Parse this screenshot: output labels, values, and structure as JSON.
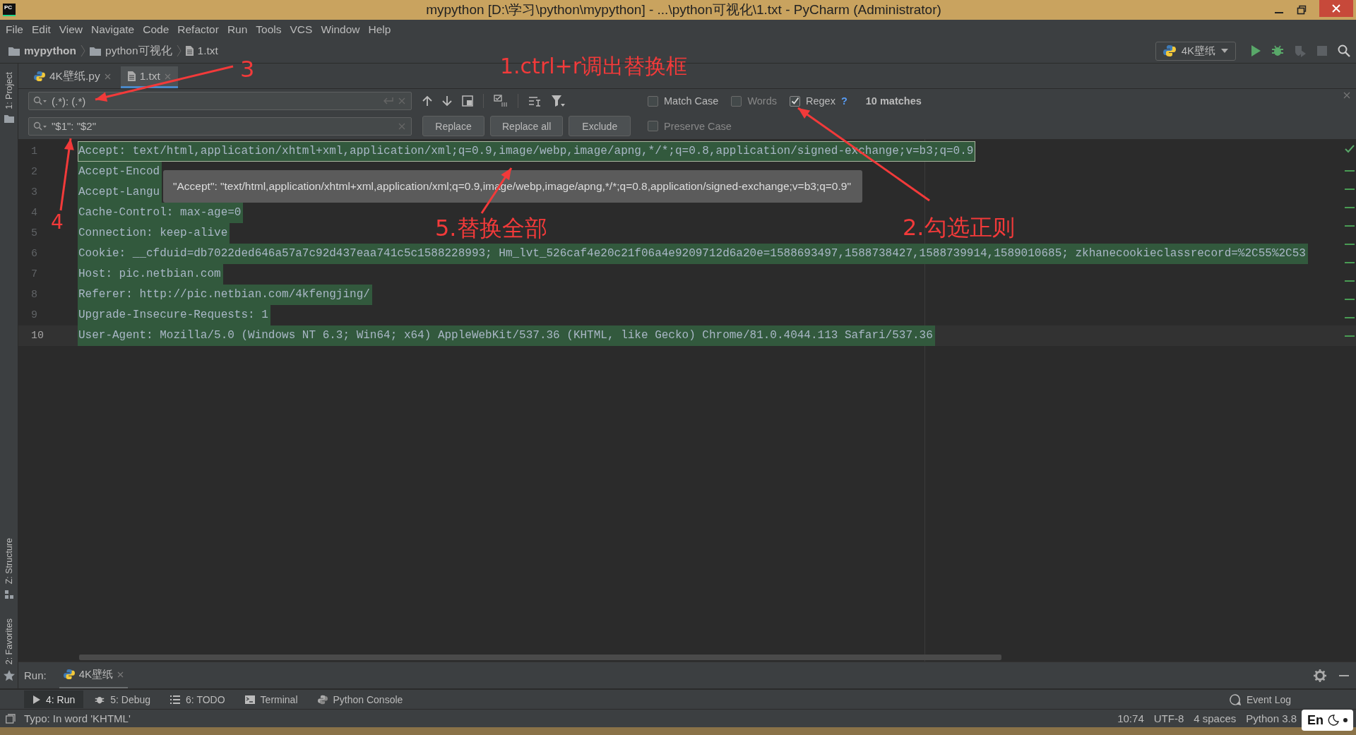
{
  "window": {
    "app_icon_text": "PC",
    "title": "mypython [D:\\学习\\python\\mypython] - ...\\python可视化\\1.txt - PyCharm (Administrator)"
  },
  "menu": [
    "File",
    "Edit",
    "View",
    "Navigate",
    "Code",
    "Refactor",
    "Run",
    "Tools",
    "VCS",
    "Window",
    "Help"
  ],
  "breadcrumbs": [
    {
      "label": "mypython",
      "kind": "project"
    },
    {
      "label": "python可视化",
      "kind": "folder"
    },
    {
      "label": "1.txt",
      "kind": "file"
    }
  ],
  "run_config": {
    "label": "4K壁纸"
  },
  "side_tabs": [
    "1: Project",
    "Z: Structure",
    "2: Favorites"
  ],
  "editor_tabs": [
    {
      "label": "4K壁纸.py",
      "kind": "python",
      "selected": false
    },
    {
      "label": "1.txt",
      "kind": "text",
      "selected": true
    }
  ],
  "find": {
    "search_value": "(.*): (.*)",
    "replace_value": "\"$1\": \"$2\"",
    "options": [
      {
        "label": "Match Case",
        "checked": false
      },
      {
        "label": "Words",
        "checked": false
      },
      {
        "label": "Regex",
        "checked": true
      }
    ],
    "help": "?",
    "matches": "10 matches",
    "buttons": [
      "Replace",
      "Replace all",
      "Exclude"
    ],
    "preserve_case": {
      "label": "Preserve Case",
      "checked": false
    }
  },
  "editor": {
    "lines": [
      {
        "number": "1",
        "text": "Accept: text/html,application/xhtml+xml,application/xml;q=0.9,image/webp,image/apng,*/*;q=0.8,application/signed-exchange;v=b3;q=0.9",
        "active_match": true,
        "current": false
      },
      {
        "number": "2",
        "text": "Accept-Encod",
        "active_match": false,
        "current": false
      },
      {
        "number": "3",
        "text": "Accept-Langu",
        "active_match": false,
        "current": false
      },
      {
        "number": "4",
        "text": "Cache-Control: max-age=0",
        "active_match": false,
        "current": false
      },
      {
        "number": "5",
        "text": "Connection: keep-alive",
        "active_match": false,
        "current": false
      },
      {
        "number": "6",
        "text": "Cookie: __cfduid=db7022ded646a57a7c92d437eaa741c5c1588228993; Hm_lvt_526caf4e20c21f06a4e9209712d6a20e=1588693497,1588738427,1588739914,1589010685; zkhanecookieclassrecord=%2C55%2C53",
        "active_match": false,
        "current": false
      },
      {
        "number": "7",
        "text": "Host: pic.netbian.com",
        "active_match": false,
        "current": false
      },
      {
        "number": "8",
        "text": "Referer: http://pic.netbian.com/4kfengjing/",
        "active_match": false,
        "current": false
      },
      {
        "number": "9",
        "text": "Upgrade-Insecure-Requests: 1",
        "active_match": false,
        "current": false
      },
      {
        "number": "10",
        "text": "User-Agent: Mozilla/5.0 (Windows NT 6.3; Win64; x64) AppleWebKit/537.36 (KHTML, like Gecko) Chrome/81.0.4044.113 Safari/537.36",
        "active_match": false,
        "current": true
      }
    ]
  },
  "tooltip": "\"Accept\": \"text/html,application/xhtml+xml,application/xml;q=0.9,image/webp,image/apng,*/*;q=0.8,application/signed-exchange;v=b3;q=0.9\"",
  "run_panel": {
    "label": "Run:",
    "tabs": [
      {
        "label": "4K壁纸",
        "selected": true
      }
    ]
  },
  "tool_tabs": [
    {
      "label": "4: Run",
      "kind": "run",
      "selected": true
    },
    {
      "label": "5: Debug",
      "kind": "debug",
      "selected": false
    },
    {
      "label": "6: TODO",
      "kind": "todo",
      "selected": false
    },
    {
      "label": "Terminal",
      "kind": "terminal",
      "selected": false
    },
    {
      "label": "Python Console",
      "kind": "python",
      "selected": false
    }
  ],
  "event_log": "Event Log",
  "status": {
    "message": "Typo: In word 'KHTML'",
    "items": [
      "10:74",
      "UTF-8",
      "4 spaces",
      "Python 3.8"
    ]
  },
  "ime": "En",
  "annotations": [
    "3",
    "1.ctrl+r调出替换框",
    "4",
    "5.替换全部",
    "2.勾选正则"
  ]
}
